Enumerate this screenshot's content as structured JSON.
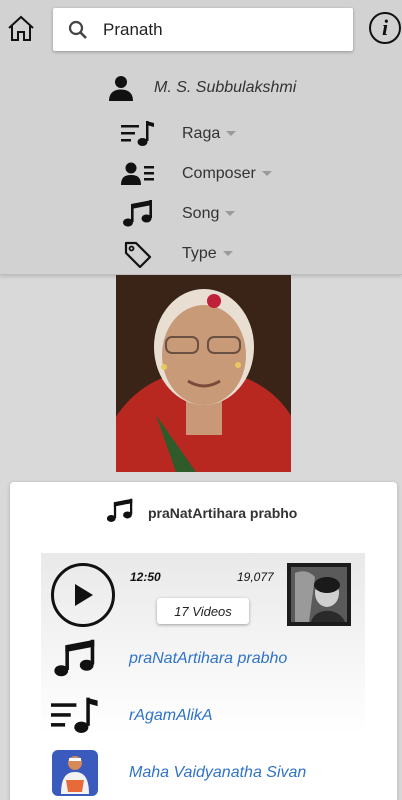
{
  "search": {
    "value": "Pranath"
  },
  "header": {
    "artist": "M. S. Subbulakshmi",
    "filters": [
      {
        "label": "Raga",
        "icon": "raga-icon"
      },
      {
        "label": "Composer",
        "icon": "composer-icon"
      },
      {
        "label": "Song",
        "icon": "music-note-icon"
      },
      {
        "label": "Type",
        "icon": "tag-icon"
      }
    ]
  },
  "card": {
    "title": "praNatArtihara prabho",
    "duration": "12:50",
    "views": "19,077",
    "videos_label": "17 Videos",
    "song": "praNatArtihara prabho",
    "raga": "rAgamAlikA",
    "composer": "Maha Vaidyanatha Sivan"
  },
  "colors": {
    "link": "#2f73c6",
    "header_bg": "#d2d2d2"
  }
}
